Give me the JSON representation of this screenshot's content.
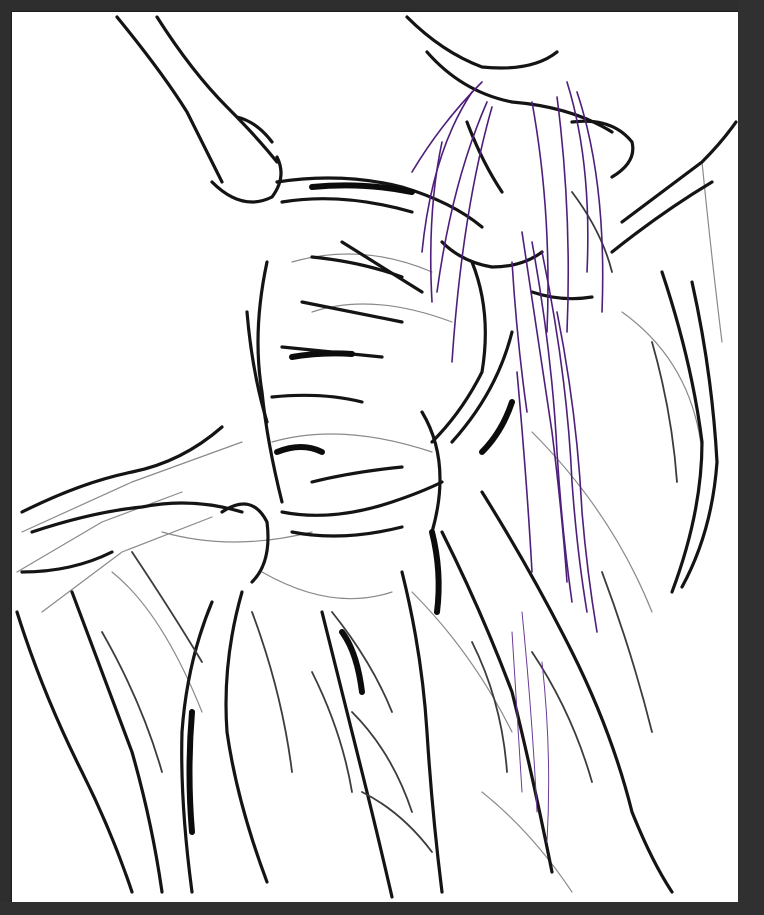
{
  "canvas": {
    "background": "#ffffff",
    "workspace_color": "#2e2e2e",
    "ink_colors": {
      "dark": "#111111",
      "mid": "#333333",
      "light": "#777777",
      "hair": "#5b2a86"
    }
  }
}
